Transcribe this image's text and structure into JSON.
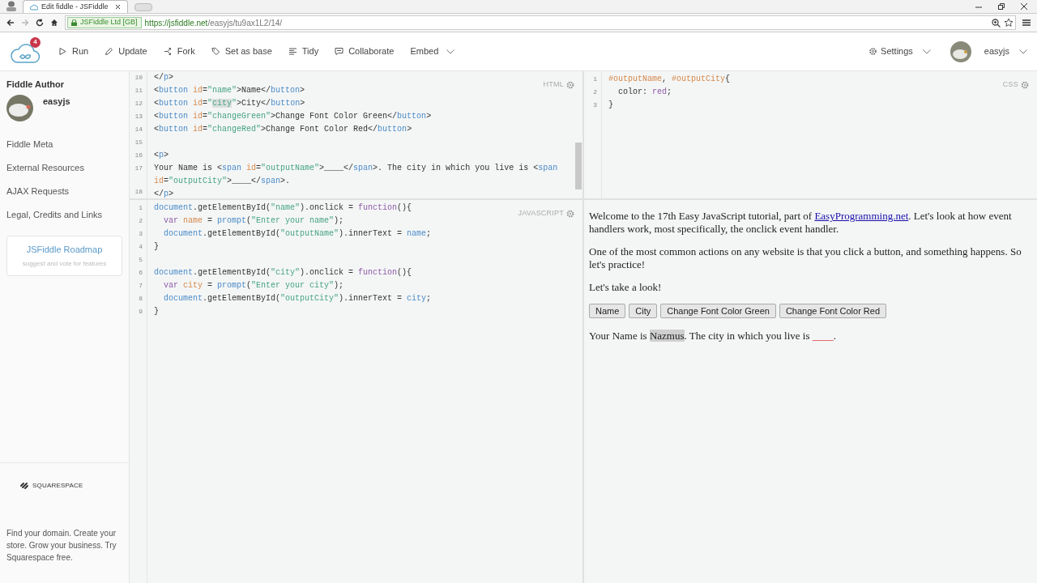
{
  "browser": {
    "tab_title": "Edit fiddle - JSFiddle",
    "security_label": "JSFiddle Ltd [GB]",
    "url_host": "https://jsfiddle.net",
    "url_path": "/easyjs/tu9ax1L2/14/"
  },
  "toolbar": {
    "notification_count": "4",
    "actions": [
      "Run",
      "Update",
      "Fork",
      "Set as base",
      "Tidy",
      "Collaborate",
      "Embed"
    ],
    "settings": "Settings",
    "user": "easyjs"
  },
  "sidebar": {
    "author_heading": "Fiddle Author",
    "author_name": "easyjs",
    "items": [
      "Fiddle Meta",
      "External Resources",
      "AJAX Requests",
      "Legal, Credits and Links"
    ],
    "roadmap": {
      "title": "JSFiddle Roadmap",
      "subtitle": "suggest and vote for features"
    },
    "sponsor": "SQUARESPACE",
    "ad_text": "Find your domain. Create your store. Grow your business. Try Squarespace free."
  },
  "html_editor": {
    "label": "HTML",
    "lines": [
      {
        "num": "10",
        "tokens": [
          {
            "kind": "plain",
            "text": "</"
          },
          {
            "kind": "tag",
            "text": "p"
          },
          {
            "kind": "plain",
            "text": ">"
          }
        ]
      },
      {
        "num": "11",
        "tokens": [
          {
            "kind": "plain",
            "text": "<"
          },
          {
            "kind": "tag",
            "text": "button"
          },
          {
            "kind": "attr",
            "text": " id"
          },
          {
            "kind": "plain",
            "text": "="
          },
          {
            "kind": "str",
            "text": "\"name\""
          },
          {
            "kind": "plain",
            "text": ">Name</"
          },
          {
            "kind": "tag",
            "text": "button"
          },
          {
            "kind": "plain",
            "text": ">"
          }
        ]
      },
      {
        "num": "12",
        "tokens": [
          {
            "kind": "plain",
            "text": "<"
          },
          {
            "kind": "tag",
            "text": "button"
          },
          {
            "kind": "attr",
            "text": " id"
          },
          {
            "kind": "plain",
            "text": "="
          },
          {
            "kind": "str",
            "text": "\""
          },
          {
            "kind": "match",
            "text": "city"
          },
          {
            "kind": "str",
            "text": "\""
          },
          {
            "kind": "plain",
            "text": ">City</"
          },
          {
            "kind": "tag",
            "text": "button"
          },
          {
            "kind": "plain",
            "text": ">"
          }
        ]
      },
      {
        "num": "13",
        "tokens": [
          {
            "kind": "plain",
            "text": "<"
          },
          {
            "kind": "tag",
            "text": "button"
          },
          {
            "kind": "attr",
            "text": " id"
          },
          {
            "kind": "plain",
            "text": "="
          },
          {
            "kind": "str",
            "text": "\"changeGreen\""
          },
          {
            "kind": "plain",
            "text": ">Change Font Color Green</"
          },
          {
            "kind": "tag",
            "text": "button"
          },
          {
            "kind": "plain",
            "text": ">"
          }
        ]
      },
      {
        "num": "14",
        "tokens": [
          {
            "kind": "plain",
            "text": "<"
          },
          {
            "kind": "tag",
            "text": "button"
          },
          {
            "kind": "attr",
            "text": " id"
          },
          {
            "kind": "plain",
            "text": "="
          },
          {
            "kind": "str",
            "text": "\"changeRed\""
          },
          {
            "kind": "plain",
            "text": ">Change Font Color Red</"
          },
          {
            "kind": "tag",
            "text": "button"
          },
          {
            "kind": "plain",
            "text": ">"
          }
        ]
      },
      {
        "num": "15"
      },
      {
        "num": "16",
        "tokens": [
          {
            "kind": "plain",
            "text": "<"
          },
          {
            "kind": "tag",
            "text": "p"
          },
          {
            "kind": "plain",
            "text": ">"
          }
        ]
      },
      {
        "num": "17",
        "tokens": [
          {
            "kind": "plain",
            "text": "Your Name is <"
          },
          {
            "kind": "tag",
            "text": "span"
          },
          {
            "kind": "attr",
            "text": " id"
          },
          {
            "kind": "plain",
            "text": "="
          },
          {
            "kind": "str",
            "text": "\"outputName\""
          },
          {
            "kind": "plain",
            "text": ">____</"
          },
          {
            "kind": "tag",
            "text": "span"
          },
          {
            "kind": "plain",
            "text": ">. The city in which you live is <"
          },
          {
            "kind": "tag",
            "text": "span"
          }
        ]
      },
      {
        "tokens": [
          {
            "kind": "attr",
            "text": "id"
          },
          {
            "kind": "plain",
            "text": "="
          },
          {
            "kind": "str",
            "text": "\"outputCity\""
          },
          {
            "kind": "plain",
            "text": ">____</"
          },
          {
            "kind": "tag",
            "text": "span"
          },
          {
            "kind": "plain",
            "text": ">."
          }
        ]
      },
      {
        "num": "18",
        "tokens": [
          {
            "kind": "plain",
            "text": "</"
          },
          {
            "kind": "tag",
            "text": "p"
          },
          {
            "kind": "plain",
            "text": ">"
          }
        ]
      }
    ]
  },
  "css_editor": {
    "label": "CSS",
    "lines": [
      {
        "num": "1",
        "tokens": [
          {
            "kind": "sel",
            "text": "#outputName"
          },
          {
            "kind": "plain",
            "text": ", "
          },
          {
            "kind": "sel",
            "text": "#outputCity"
          },
          {
            "kind": "plain",
            "text": "{"
          }
        ]
      },
      {
        "num": "2",
        "tokens": [
          {
            "kind": "plain",
            "text": "  color: "
          },
          {
            "kind": "kw",
            "text": "red"
          },
          {
            "kind": "plain",
            "text": ";"
          }
        ]
      },
      {
        "num": "3",
        "tokens": [
          {
            "kind": "plain",
            "text": "}"
          }
        ]
      }
    ]
  },
  "js_editor": {
    "label": "JAVASCRIPT",
    "lines": [
      {
        "num": "1",
        "tokens": [
          {
            "kind": "tag",
            "text": "document"
          },
          {
            "kind": "plain",
            "text": ".getElementById("
          },
          {
            "kind": "str",
            "text": "\"name\""
          },
          {
            "kind": "plain",
            "text": ").onclick = "
          },
          {
            "kind": "kw",
            "text": "function"
          },
          {
            "kind": "plain",
            "text": "(){"
          }
        ]
      },
      {
        "num": "2",
        "tokens": [
          {
            "kind": "kw",
            "text": "  var"
          },
          {
            "kind": "attr",
            "text": " name"
          },
          {
            "kind": "plain",
            "text": " = "
          },
          {
            "kind": "tag",
            "text": "prompt"
          },
          {
            "kind": "plain",
            "text": "("
          },
          {
            "kind": "str",
            "text": "\"Enter your name\""
          },
          {
            "kind": "plain",
            "text": ");"
          }
        ]
      },
      {
        "num": "3",
        "tokens": [
          {
            "kind": "tag",
            "text": "  document"
          },
          {
            "kind": "plain",
            "text": ".getElementById("
          },
          {
            "kind": "str",
            "text": "\"outputName\""
          },
          {
            "kind": "plain",
            "text": ").innerText = "
          },
          {
            "kind": "tag",
            "text": "name"
          },
          {
            "kind": "plain",
            "text": ";"
          }
        ]
      },
      {
        "num": "4",
        "tokens": [
          {
            "kind": "plain",
            "text": "}"
          }
        ]
      },
      {
        "num": "5"
      },
      {
        "num": "6",
        "tokens": [
          {
            "kind": "tag",
            "text": "document"
          },
          {
            "kind": "plain",
            "text": ".getElementById("
          },
          {
            "kind": "str",
            "text": "\"city\""
          },
          {
            "kind": "plain",
            "text": ").onclick = "
          },
          {
            "kind": "kw",
            "text": "function"
          },
          {
            "kind": "plain",
            "text": "(){"
          }
        ]
      },
      {
        "num": "7",
        "tokens": [
          {
            "kind": "kw",
            "text": "  var"
          },
          {
            "kind": "attr",
            "text": " city"
          },
          {
            "kind": "plain",
            "text": " = "
          },
          {
            "kind": "tag",
            "text": "prompt"
          },
          {
            "kind": "plain",
            "text": "("
          },
          {
            "kind": "str",
            "text": "\"Enter your city\""
          },
          {
            "kind": "plain",
            "text": ");"
          }
        ]
      },
      {
        "num": "8",
        "tokens": [
          {
            "kind": "tag",
            "text": "  document"
          },
          {
            "kind": "plain",
            "text": ".getElementById("
          },
          {
            "kind": "str",
            "text": "\"outputCity\""
          },
          {
            "kind": "plain",
            "text": ").innerText = "
          },
          {
            "kind": "tag",
            "text": "city"
          },
          {
            "kind": "plain",
            "text": ";"
          }
        ]
      },
      {
        "num": "9",
        "tokens": [
          {
            "kind": "plain",
            "text": "}"
          }
        ]
      }
    ]
  },
  "output": {
    "intro_before_link": "Welcome to the 17th Easy JavaScript tutorial, part of ",
    "link": "EasyProgramming.net",
    "intro_after_link": ". Let's look at how event handlers work, most specifically, the onclick event handler.",
    "paragraph_2": "One of the most common actions on any website is that you click a button, and something happens. So let's practice!",
    "paragraph_3": "Let's take a look!",
    "buttons": [
      "Name",
      "City",
      "Change Font Color Green",
      "Change Font Color Red"
    ],
    "result_before_name": "Your Name is ",
    "name_value": "Nazmus",
    "result_middle": ". The city in which you live is ",
    "city_value": "____",
    "result_end": "."
  }
}
